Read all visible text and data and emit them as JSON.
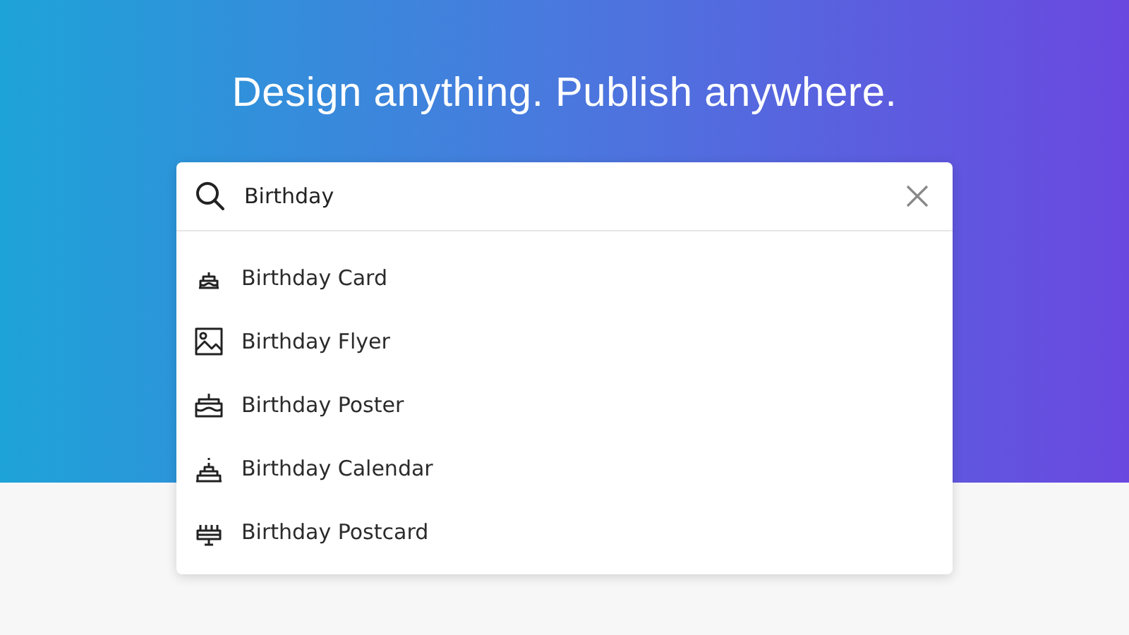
{
  "headline": "Design anything. Publish anywhere.",
  "search": {
    "value": "Birthday"
  },
  "suggestions": [
    {
      "label": "Birthday Card",
      "kind": "cake"
    },
    {
      "label": "Birthday Flyer",
      "kind": "image"
    },
    {
      "label": "Birthday Poster",
      "kind": "cake-box"
    },
    {
      "label": "Birthday Calendar",
      "kind": "tiered-cake"
    },
    {
      "label": "Birthday Postcard",
      "kind": "candle-cake"
    }
  ]
}
